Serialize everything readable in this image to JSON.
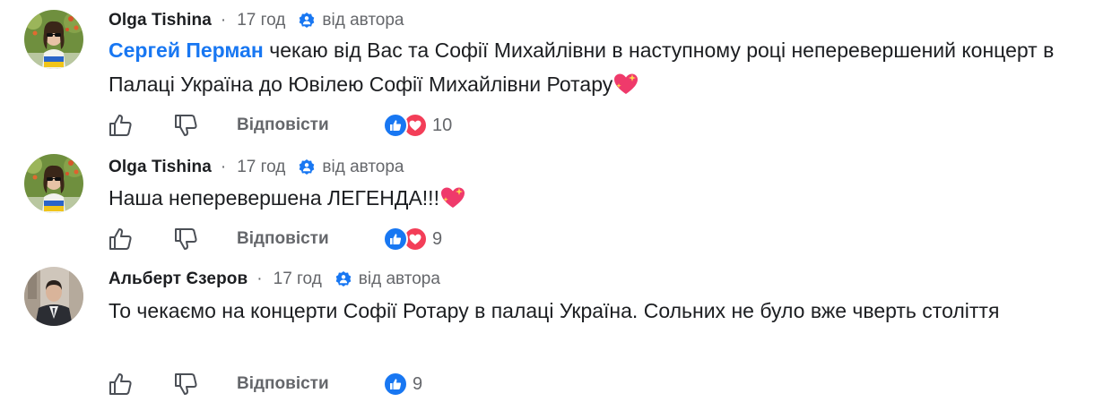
{
  "comments": [
    {
      "author": "Olga Tishina",
      "separator": "·",
      "time": "17 год",
      "badge": "від автора",
      "mention": "Сергей Перман",
      "text": " чекаю від Вас та Софії Михайлівни в наступному році неперевершений концерт в Палаці Україна до Ювілею Софії Михайлівни Ротару",
      "emoji": "sparkling-heart",
      "reply": "Відповісти",
      "reactions": [
        "like",
        "love"
      ],
      "reaction_count": "10"
    },
    {
      "author": "Olga Tishina",
      "separator": "·",
      "time": "17 год",
      "badge": "від автора",
      "text": "Наша неперевершена ЛЕГЕНДА!!!",
      "emoji": "sparkling-heart",
      "reply": "Відповісти",
      "reactions": [
        "like",
        "love"
      ],
      "reaction_count": "9"
    },
    {
      "author": "Альберт Єзеров",
      "separator": "·",
      "time": "17 год",
      "badge": "від автора",
      "text": "То чекаємо на концерти Софії Ротару в палаці Україна. Сольних не було вже чверть століття",
      "reply": "Відповісти",
      "reactions": [
        "like"
      ],
      "reaction_count": "9"
    }
  ],
  "colors": {
    "link": "#1877f2",
    "secondary_text": "#65676b",
    "like": "#1877f2",
    "love": "#f33e58"
  },
  "icons": [
    "thumbs-up-icon",
    "thumbs-down-icon",
    "verified-badge-icon",
    "like-reaction-icon",
    "love-reaction-icon",
    "sparkling-heart-emoji"
  ]
}
